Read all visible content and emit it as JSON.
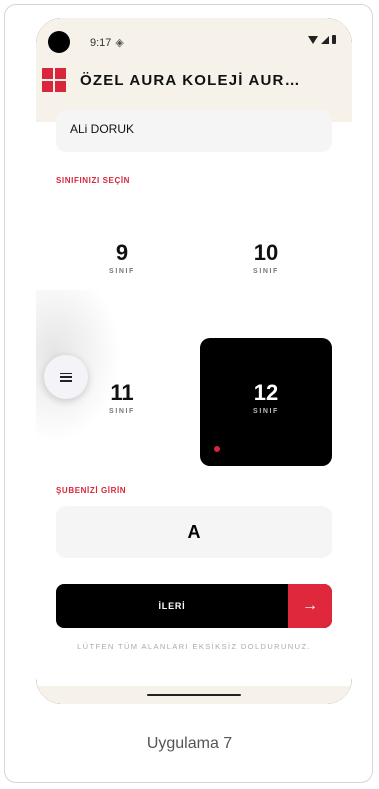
{
  "status_bar": {
    "time": "9:17",
    "notification_icon": "data-saver-icon"
  },
  "app_bar": {
    "title": "ÖZEL AURA KOLEJİ AUR…",
    "logo_color": "#d9263a"
  },
  "form": {
    "name_value": "ALi DORUK",
    "grade_section_label": "SINIFINIZI SEÇİN",
    "grades": [
      {
        "number": "9",
        "sub": "SINIF",
        "selected": false
      },
      {
        "number": "10",
        "sub": "SINIF",
        "selected": false
      },
      {
        "number": "11",
        "sub": "SINIF",
        "selected": false
      },
      {
        "number": "12",
        "sub": "SINIF",
        "selected": true
      }
    ],
    "branch_section_label": "ŞUBENİZİ GİRİN",
    "branch_value": "A",
    "next_label": "İLERİ",
    "next_icon": "arrow-right-icon",
    "hint": "LÜTFEN TÜM ALANLARI EKSİKSİZ DOLDURUNUZ."
  },
  "fab": {
    "icon": "menu-icon"
  },
  "colors": {
    "accent": "#d9263a",
    "button_arrow_bg": "#e0283c",
    "appbar_bg": "#f6f2ea",
    "selected_grade_bg": "#000000"
  },
  "caption": "Uygulama 7"
}
